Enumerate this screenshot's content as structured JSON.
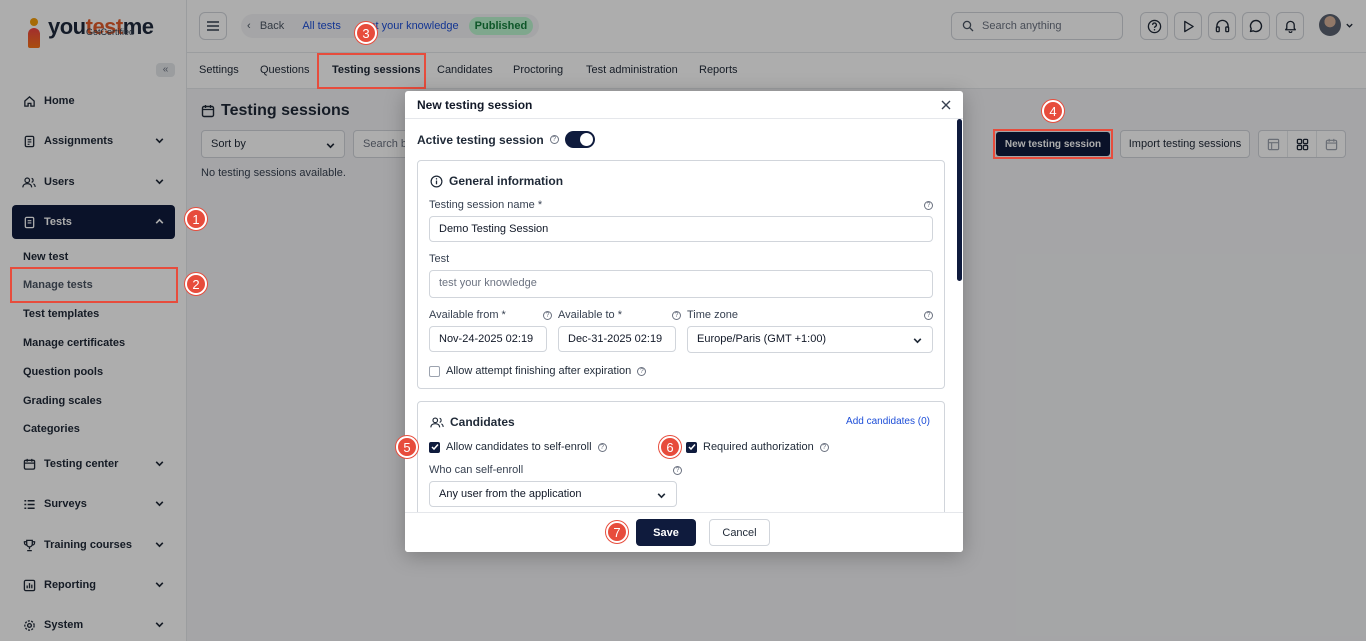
{
  "app": {
    "logo_main": "you",
    "logo_accent": "test",
    "logo_rest": "me",
    "logo_sub": "GetCertified"
  },
  "sidebar": {
    "collapse_glyph": "«",
    "items": [
      {
        "label": "Home",
        "icon": "home-icon"
      },
      {
        "label": "Assignments",
        "icon": "assignments-icon"
      },
      {
        "label": "Users",
        "icon": "users-icon"
      },
      {
        "label": "Tests",
        "icon": "tests-icon"
      },
      {
        "label": "Testing center",
        "icon": "testing-center-icon"
      },
      {
        "label": "Surveys",
        "icon": "surveys-icon"
      },
      {
        "label": "Training courses",
        "icon": "trophy-icon"
      },
      {
        "label": "Reporting",
        "icon": "reporting-icon"
      },
      {
        "label": "System",
        "icon": "gear-icon"
      }
    ],
    "tests_subitems": [
      "New test",
      "Manage tests",
      "Test templates",
      "Manage certificates",
      "Question pools",
      "Grading scales",
      "Categories"
    ]
  },
  "topbar": {
    "back": "Back",
    "crumb_all_tests": "All tests",
    "crumb_test": "test your knowledge",
    "status_badge": "Published",
    "search_placeholder": "Search anything"
  },
  "tabs": [
    "Settings",
    "Questions",
    "Testing sessions",
    "Candidates",
    "Proctoring",
    "Test administration",
    "Reports"
  ],
  "main": {
    "title": "Testing sessions",
    "sort_by": "Sort by",
    "search_placeholder": "Search by",
    "empty": "No testing sessions available.",
    "new_session_button": "New testing session",
    "import_button": "Import testing sessions"
  },
  "modal": {
    "title": "New testing session",
    "active_label": "Active testing session",
    "active_on": true,
    "general": {
      "title": "General information",
      "name_label": "Testing session name *",
      "name_value": "Demo Testing Session",
      "test_label": "Test",
      "test_placeholder": "test your knowledge",
      "from_label": "Available from *",
      "from_value": "Nov-24-2025 02:19",
      "to_label": "Available to *",
      "to_value": "Dec-31-2025 02:19",
      "tz_label": "Time zone",
      "tz_value": "Europe/Paris (GMT +1:00)",
      "allow_finish_label": "Allow attempt finishing after expiration"
    },
    "candidates": {
      "title": "Candidates",
      "add_link": "Add candidates (0)",
      "self_enroll_label": "Allow candidates to self-enroll",
      "required_auth_label": "Required authorization",
      "who_label": "Who can self-enroll",
      "who_value": "Any user from the application"
    },
    "save": "Save",
    "cancel": "Cancel"
  },
  "markers": [
    "1",
    "2",
    "3",
    "4",
    "5",
    "6",
    "7"
  ],
  "colors": {
    "primary": "#0f1b3d",
    "highlight": "#e74c3c",
    "link": "#1d4ed8",
    "badge_bg": "#bbf7d0"
  }
}
